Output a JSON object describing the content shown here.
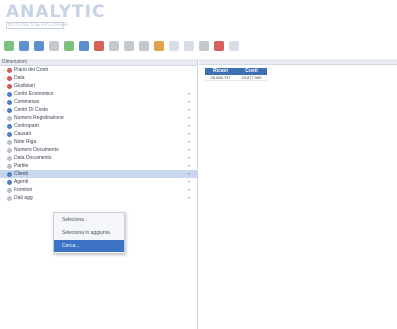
{
  "logo": {
    "main": "ANALYTIC",
    "sub_left": "BUSINESS",
    "sub_right": "EXPLORER"
  },
  "toolbar": {
    "buttons": [
      "refresh-icon",
      "save-icon",
      "floppy-icon",
      "grid-icon",
      "add-icon",
      "up-arrow-icon",
      "gift-icon",
      "table-icon",
      "filter-icon",
      "table-settings-icon",
      "settings-icon",
      "export-icon",
      "export-excel-icon",
      "chart-icon",
      "delete-icon",
      "clear-icon"
    ]
  },
  "left_panel": {
    "header": "Dimensioni",
    "items": [
      {
        "label": "Piano dei Conti",
        "expanded": false,
        "icon": "red"
      },
      {
        "label": "Data",
        "expanded": false,
        "icon": "red"
      },
      {
        "label": "Giudiziari",
        "expanded": false,
        "icon": "red"
      },
      {
        "label": "Conto Economico",
        "expanded": false,
        "icon": "blue"
      },
      {
        "label": "Commesse",
        "expanded": false,
        "icon": "blue"
      },
      {
        "label": "Centri Di Costo",
        "expanded": false,
        "icon": "blue"
      },
      {
        "label": "Numero Registrazione",
        "expanded": false,
        "icon": "leaf"
      },
      {
        "label": "Controparti",
        "expanded": false,
        "icon": "blue"
      },
      {
        "label": "Causali",
        "expanded": false,
        "icon": "blue"
      },
      {
        "label": "Note Riga",
        "expanded": false,
        "icon": "leaf"
      },
      {
        "label": "Numero Documento",
        "expanded": false,
        "icon": "leaf"
      },
      {
        "label": "Data Documento",
        "expanded": false,
        "icon": "leaf"
      },
      {
        "label": "Partite",
        "expanded": false,
        "icon": "leaf"
      },
      {
        "label": "Clienti",
        "expanded": false,
        "icon": "blue"
      },
      {
        "label": "Agenti",
        "expanded": false,
        "icon": "blue"
      },
      {
        "label": "Fornitori",
        "expanded": false,
        "icon": "leaf"
      },
      {
        "label": "Dati agg",
        "expanded": false,
        "icon": "leaf"
      }
    ]
  },
  "grid": {
    "columns": [
      "Ricavi",
      "Costi"
    ],
    "rows": [
      [
        "26.088.797",
        "20.877.595"
      ]
    ]
  },
  "context_menu": {
    "items": [
      "Seleziona",
      "Seleziona in aggiunta",
      "Cerca..."
    ],
    "active_index": 2
  },
  "colors": {
    "accent": "#3d73c4",
    "grid_header": "#3f6fb3",
    "logo": "#c7d3e4"
  }
}
